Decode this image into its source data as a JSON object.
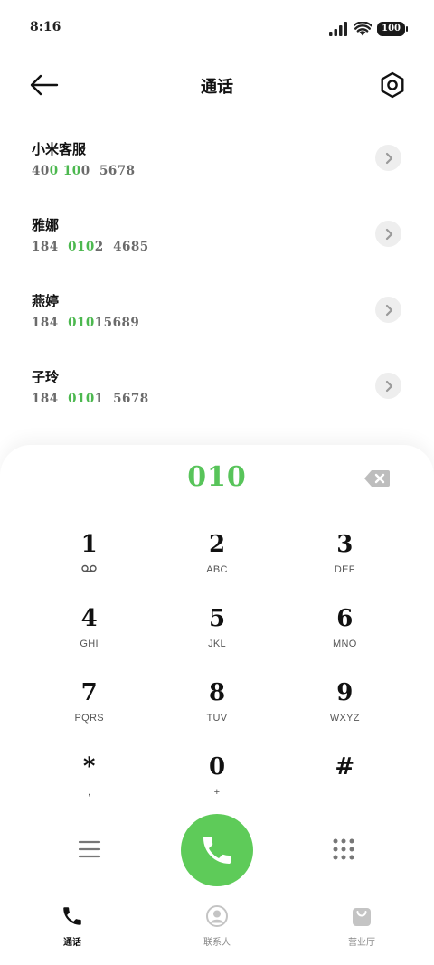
{
  "status_bar": {
    "time": "8:16",
    "battery": "100"
  },
  "header": {
    "title": "通话"
  },
  "contacts": [
    {
      "name": "小米客服",
      "number_parts": [
        {
          "t": "40",
          "hl": false
        },
        {
          "t": "0",
          "hl": true
        },
        {
          "t": " ",
          "hl": false
        },
        {
          "t": "10",
          "hl": true
        },
        {
          "t": "0  5678",
          "hl": false
        }
      ]
    },
    {
      "name": "雅娜",
      "number_parts": [
        {
          "t": "184  ",
          "hl": false
        },
        {
          "t": "010",
          "hl": true
        },
        {
          "t": "2  4685",
          "hl": false
        }
      ]
    },
    {
      "name": "燕婷",
      "number_parts": [
        {
          "t": "184  ",
          "hl": false
        },
        {
          "t": "010",
          "hl": true
        },
        {
          "t": "15689",
          "hl": false
        }
      ]
    },
    {
      "name": "子玲",
      "number_parts": [
        {
          "t": "184  ",
          "hl": false
        },
        {
          "t": "010",
          "hl": true
        },
        {
          "t": "1  5678",
          "hl": false
        }
      ]
    }
  ],
  "dialer": {
    "input": "010",
    "keys": [
      {
        "digit": "1",
        "sub": "",
        "sub_icon": "voicemail-icon"
      },
      {
        "digit": "2",
        "sub": "ABC"
      },
      {
        "digit": "3",
        "sub": "DEF"
      },
      {
        "digit": "4",
        "sub": "GHI"
      },
      {
        "digit": "5",
        "sub": "JKL"
      },
      {
        "digit": "6",
        "sub": "MNO"
      },
      {
        "digit": "7",
        "sub": "PQRS"
      },
      {
        "digit": "8",
        "sub": "TUV"
      },
      {
        "digit": "9",
        "sub": "WXYZ"
      },
      {
        "digit": "*",
        "sub": ","
      },
      {
        "digit": "0",
        "sub": "+"
      },
      {
        "digit": "#",
        "sub": ""
      }
    ]
  },
  "bottom_nav": [
    {
      "label": "通话",
      "icon": "phone-icon",
      "active": true
    },
    {
      "label": "联系人",
      "icon": "person-icon",
      "active": false
    },
    {
      "label": "营业厅",
      "icon": "bag-icon",
      "active": false
    }
  ],
  "colors": {
    "accent_green": "#58c45a",
    "call_button": "#5ecb59",
    "highlight": "#4cb84f"
  }
}
